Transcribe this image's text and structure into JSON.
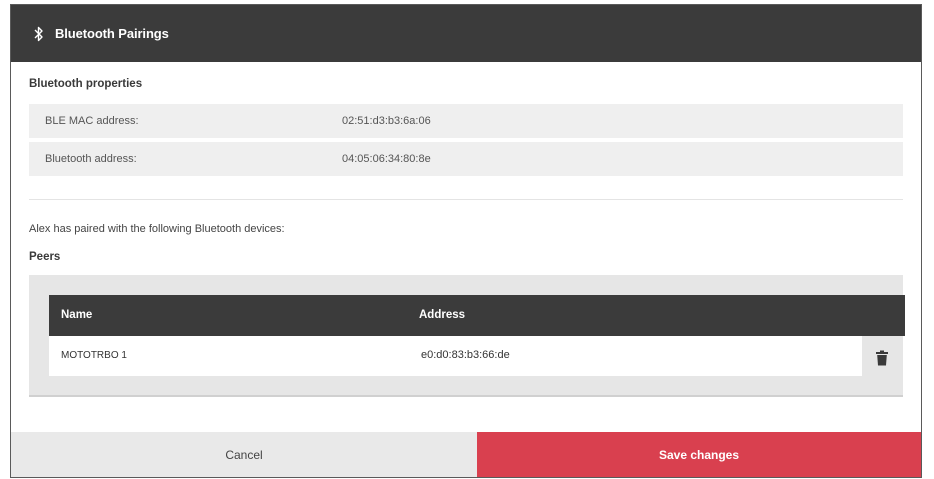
{
  "header": {
    "title": "Bluetooth Pairings",
    "icon": "bluetooth-icon"
  },
  "properties": {
    "title": "Bluetooth properties",
    "rows": [
      {
        "label": "BLE MAC address:",
        "value": "02:51:d3:b3:6a:06"
      },
      {
        "label": "Bluetooth address:",
        "value": "04:05:06:34:80:8e"
      }
    ]
  },
  "peers": {
    "intro": "Alex has paired with the following Bluetooth devices:",
    "title": "Peers",
    "columns": {
      "name": "Name",
      "address": "Address"
    },
    "rows": [
      {
        "name": "MOTOTRBO 1",
        "address": "e0:d0:83:b3:66:de",
        "action_icon": "trash-icon"
      }
    ]
  },
  "footer": {
    "cancel_label": "Cancel",
    "save_label": "Save changes"
  },
  "colors": {
    "header_bg": "#3b3b3b",
    "save_bg": "#d9404f",
    "cancel_bg": "#e9e9e9"
  }
}
